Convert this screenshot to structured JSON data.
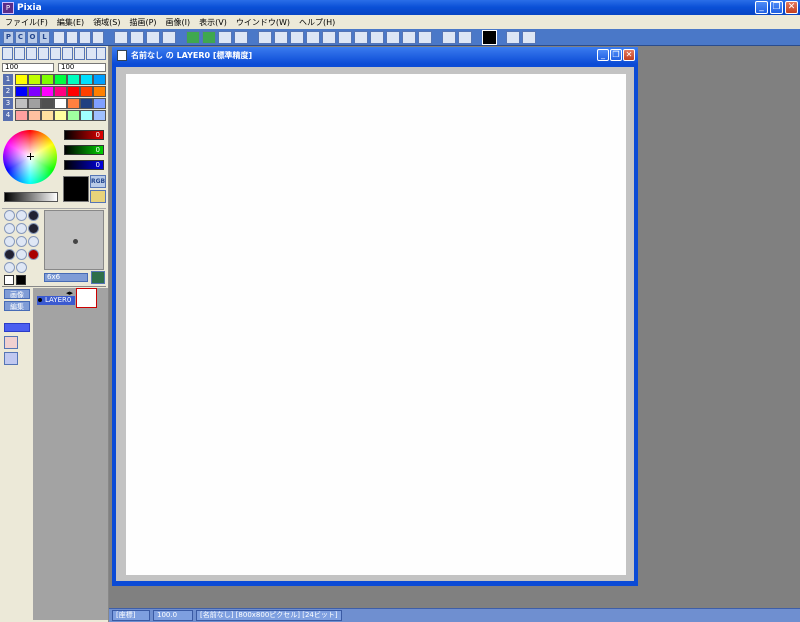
{
  "app": {
    "title": "Pixia"
  },
  "window_buttons": {
    "minimize": "_",
    "restore": "❐",
    "close": "✕"
  },
  "menu": [
    "ファイル(F)",
    "編集(E)",
    "領域(S)",
    "描画(P)",
    "画像(I)",
    "表示(V)",
    "ウインドウ(W)",
    "ヘルプ(H)"
  ],
  "left_toolbar": {
    "buttons": [
      "P",
      "C",
      "O",
      "L"
    ]
  },
  "colors": {
    "palette_rows": [
      [
        "#ffff00",
        "#c0ff00",
        "#80ff00",
        "#00ff40",
        "#00ffc0",
        "#00e0ff",
        "#00a0ff"
      ],
      [
        "#0000ff",
        "#8000ff",
        "#ff00ff",
        "#ff0080",
        "#ff0000",
        "#ff4000",
        "#ff8000"
      ],
      [
        "#c0c0c0",
        "#a0a0a0",
        "#505050",
        "#ffffff",
        "#ff8040",
        "#204080",
        "#80a0ff"
      ],
      [
        "#ffa0a0",
        "#ffc0a0",
        "#ffe0a0",
        "#ffffa0",
        "#a0ffa0",
        "#a0ffff",
        "#a0c0ff"
      ]
    ],
    "row_labels": [
      "1",
      "2",
      "3",
      "4"
    ]
  },
  "sliders": {
    "opacity_a": "100",
    "opacity_b": "100"
  },
  "rgb": {
    "r": "0",
    "g": "0",
    "b": "0",
    "mode_label": "RGB"
  },
  "brush": {
    "size_label": "6x6"
  },
  "layers": {
    "tab_image": "画像",
    "tab_edit": "編集",
    "layer_name": "LAYER0"
  },
  "canvas_window": {
    "title": "名前なし の LAYER0 [標準精度]"
  },
  "status": {
    "mode": "[座標]",
    "zoom": "100.0",
    "info": "[名前なし] [800x800ピクセル] [24ビット]"
  }
}
